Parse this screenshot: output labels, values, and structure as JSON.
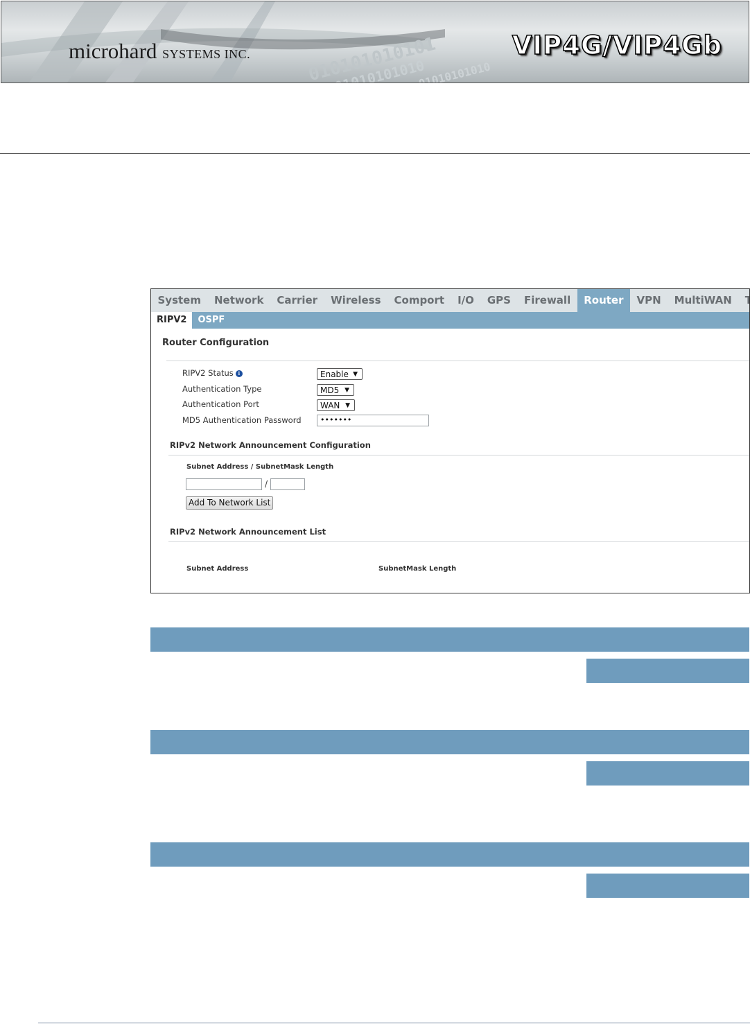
{
  "header": {
    "company_main": "microhard",
    "company_suffix": "SYSTEMS INC.",
    "product": "VIP4G/VIP4Gb",
    "binary_lines": [
      "010101010101",
      "0101010101010",
      "01010101010"
    ]
  },
  "main_nav": {
    "items": [
      "System",
      "Network",
      "Carrier",
      "Wireless",
      "Comport",
      "I/O",
      "GPS",
      "Firewall",
      "Router",
      "VPN",
      "MultiWAN",
      "Tools"
    ],
    "active": "Router"
  },
  "sub_nav": {
    "items": [
      "RIPV2",
      "OSPF"
    ],
    "active": "RIPV2"
  },
  "router_config": {
    "title": "Router Configuration",
    "fields": [
      {
        "label": "RIPV2 Status",
        "value": "Enable",
        "type": "select",
        "info": true
      },
      {
        "label": "Authentication Type",
        "value": "MD5",
        "type": "select"
      },
      {
        "label": "Authentication Port",
        "value": "WAN",
        "type": "select"
      },
      {
        "label": "MD5 Authentication Password",
        "value": "•••••••",
        "type": "password"
      }
    ]
  },
  "announcement_config": {
    "title": "RIPv2 Network Announcement Configuration",
    "subnet_label": "Subnet Address / SubnetMask Length",
    "separator": "/",
    "subnet_value": "",
    "mask_value": "",
    "add_button": "Add To Network List"
  },
  "announcement_list": {
    "title": "RIPv2 Network Announcement List",
    "columns": [
      "Subnet Address",
      "SubnetMask Length"
    ]
  },
  "colors": {
    "accent": "#7ea8c3",
    "bar": "#6f9cbd",
    "nav_bg": "#dde3e6"
  },
  "icons": [
    "info-icon",
    "dropdown-caret-icon"
  ]
}
